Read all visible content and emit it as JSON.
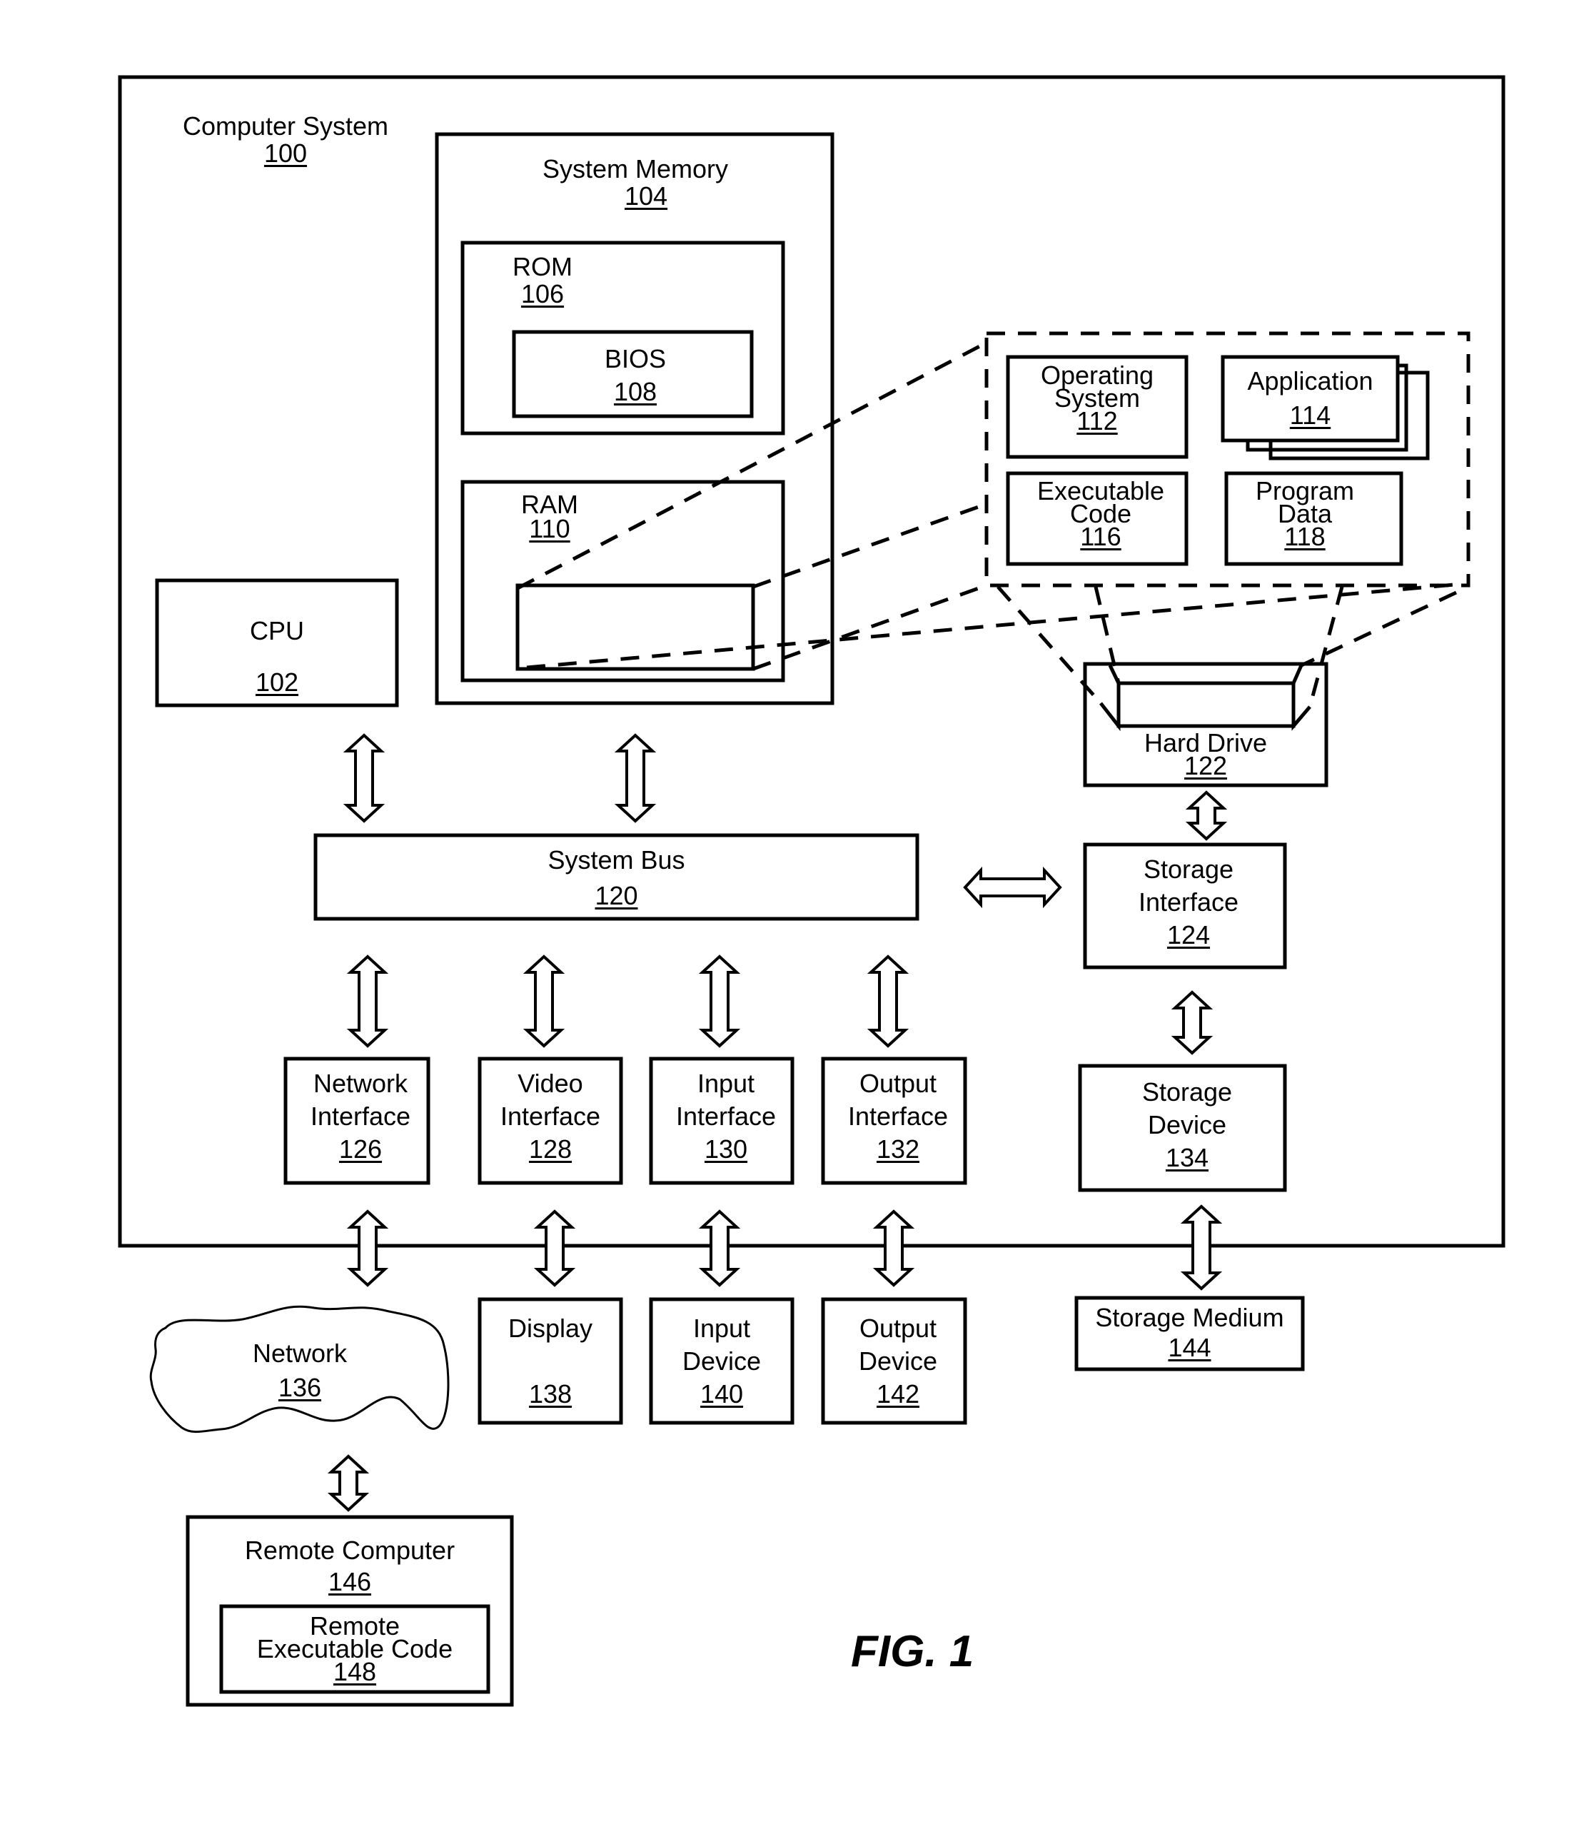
{
  "figure_label": "FIG. 1",
  "computer_system": {
    "title": "Computer System",
    "ref": "100"
  },
  "system_memory": {
    "title": "System Memory",
    "ref": "104"
  },
  "rom": {
    "title": "ROM",
    "ref": "106"
  },
  "bios": {
    "title": "BIOS",
    "ref": "108"
  },
  "ram": {
    "title": "RAM",
    "ref": "110"
  },
  "cpu": {
    "title": "CPU",
    "ref": "102"
  },
  "operating_system": {
    "lines": [
      "Operating",
      "System"
    ],
    "ref": "112"
  },
  "application": {
    "title": "Application",
    "ref": "114"
  },
  "executable_code": {
    "lines": [
      "Executable",
      "Code"
    ],
    "ref": "116"
  },
  "program_data": {
    "lines": [
      "Program",
      "Data"
    ],
    "ref": "118"
  },
  "hard_drive": {
    "title": "Hard Drive",
    "ref": "122"
  },
  "system_bus": {
    "title": "System Bus",
    "ref": "120"
  },
  "storage_interface": {
    "lines": [
      "Storage",
      "Interface"
    ],
    "ref": "124"
  },
  "network_interface": {
    "lines": [
      "Network",
      "Interface"
    ],
    "ref": "126"
  },
  "video_interface": {
    "lines": [
      "Video",
      "Interface"
    ],
    "ref": "128"
  },
  "input_interface": {
    "lines": [
      "Input",
      "Interface"
    ],
    "ref": "130"
  },
  "output_interface": {
    "lines": [
      "Output",
      "Interface"
    ],
    "ref": "132"
  },
  "storage_device": {
    "lines": [
      "Storage",
      "Device"
    ],
    "ref": "134"
  },
  "storage_medium": {
    "title": "Storage Medium",
    "ref": "144"
  },
  "network": {
    "title": "Network",
    "ref": "136"
  },
  "display": {
    "title": "Display",
    "ref": "138"
  },
  "input_device": {
    "lines": [
      "Input",
      "Device"
    ],
    "ref": "140"
  },
  "output_device": {
    "lines": [
      "Output",
      "Device"
    ],
    "ref": "142"
  },
  "remote_computer": {
    "title": "Remote Computer",
    "ref": "146"
  },
  "remote_executable_code": {
    "lines": [
      "Remote",
      "Executable Code"
    ],
    "ref": "148"
  }
}
